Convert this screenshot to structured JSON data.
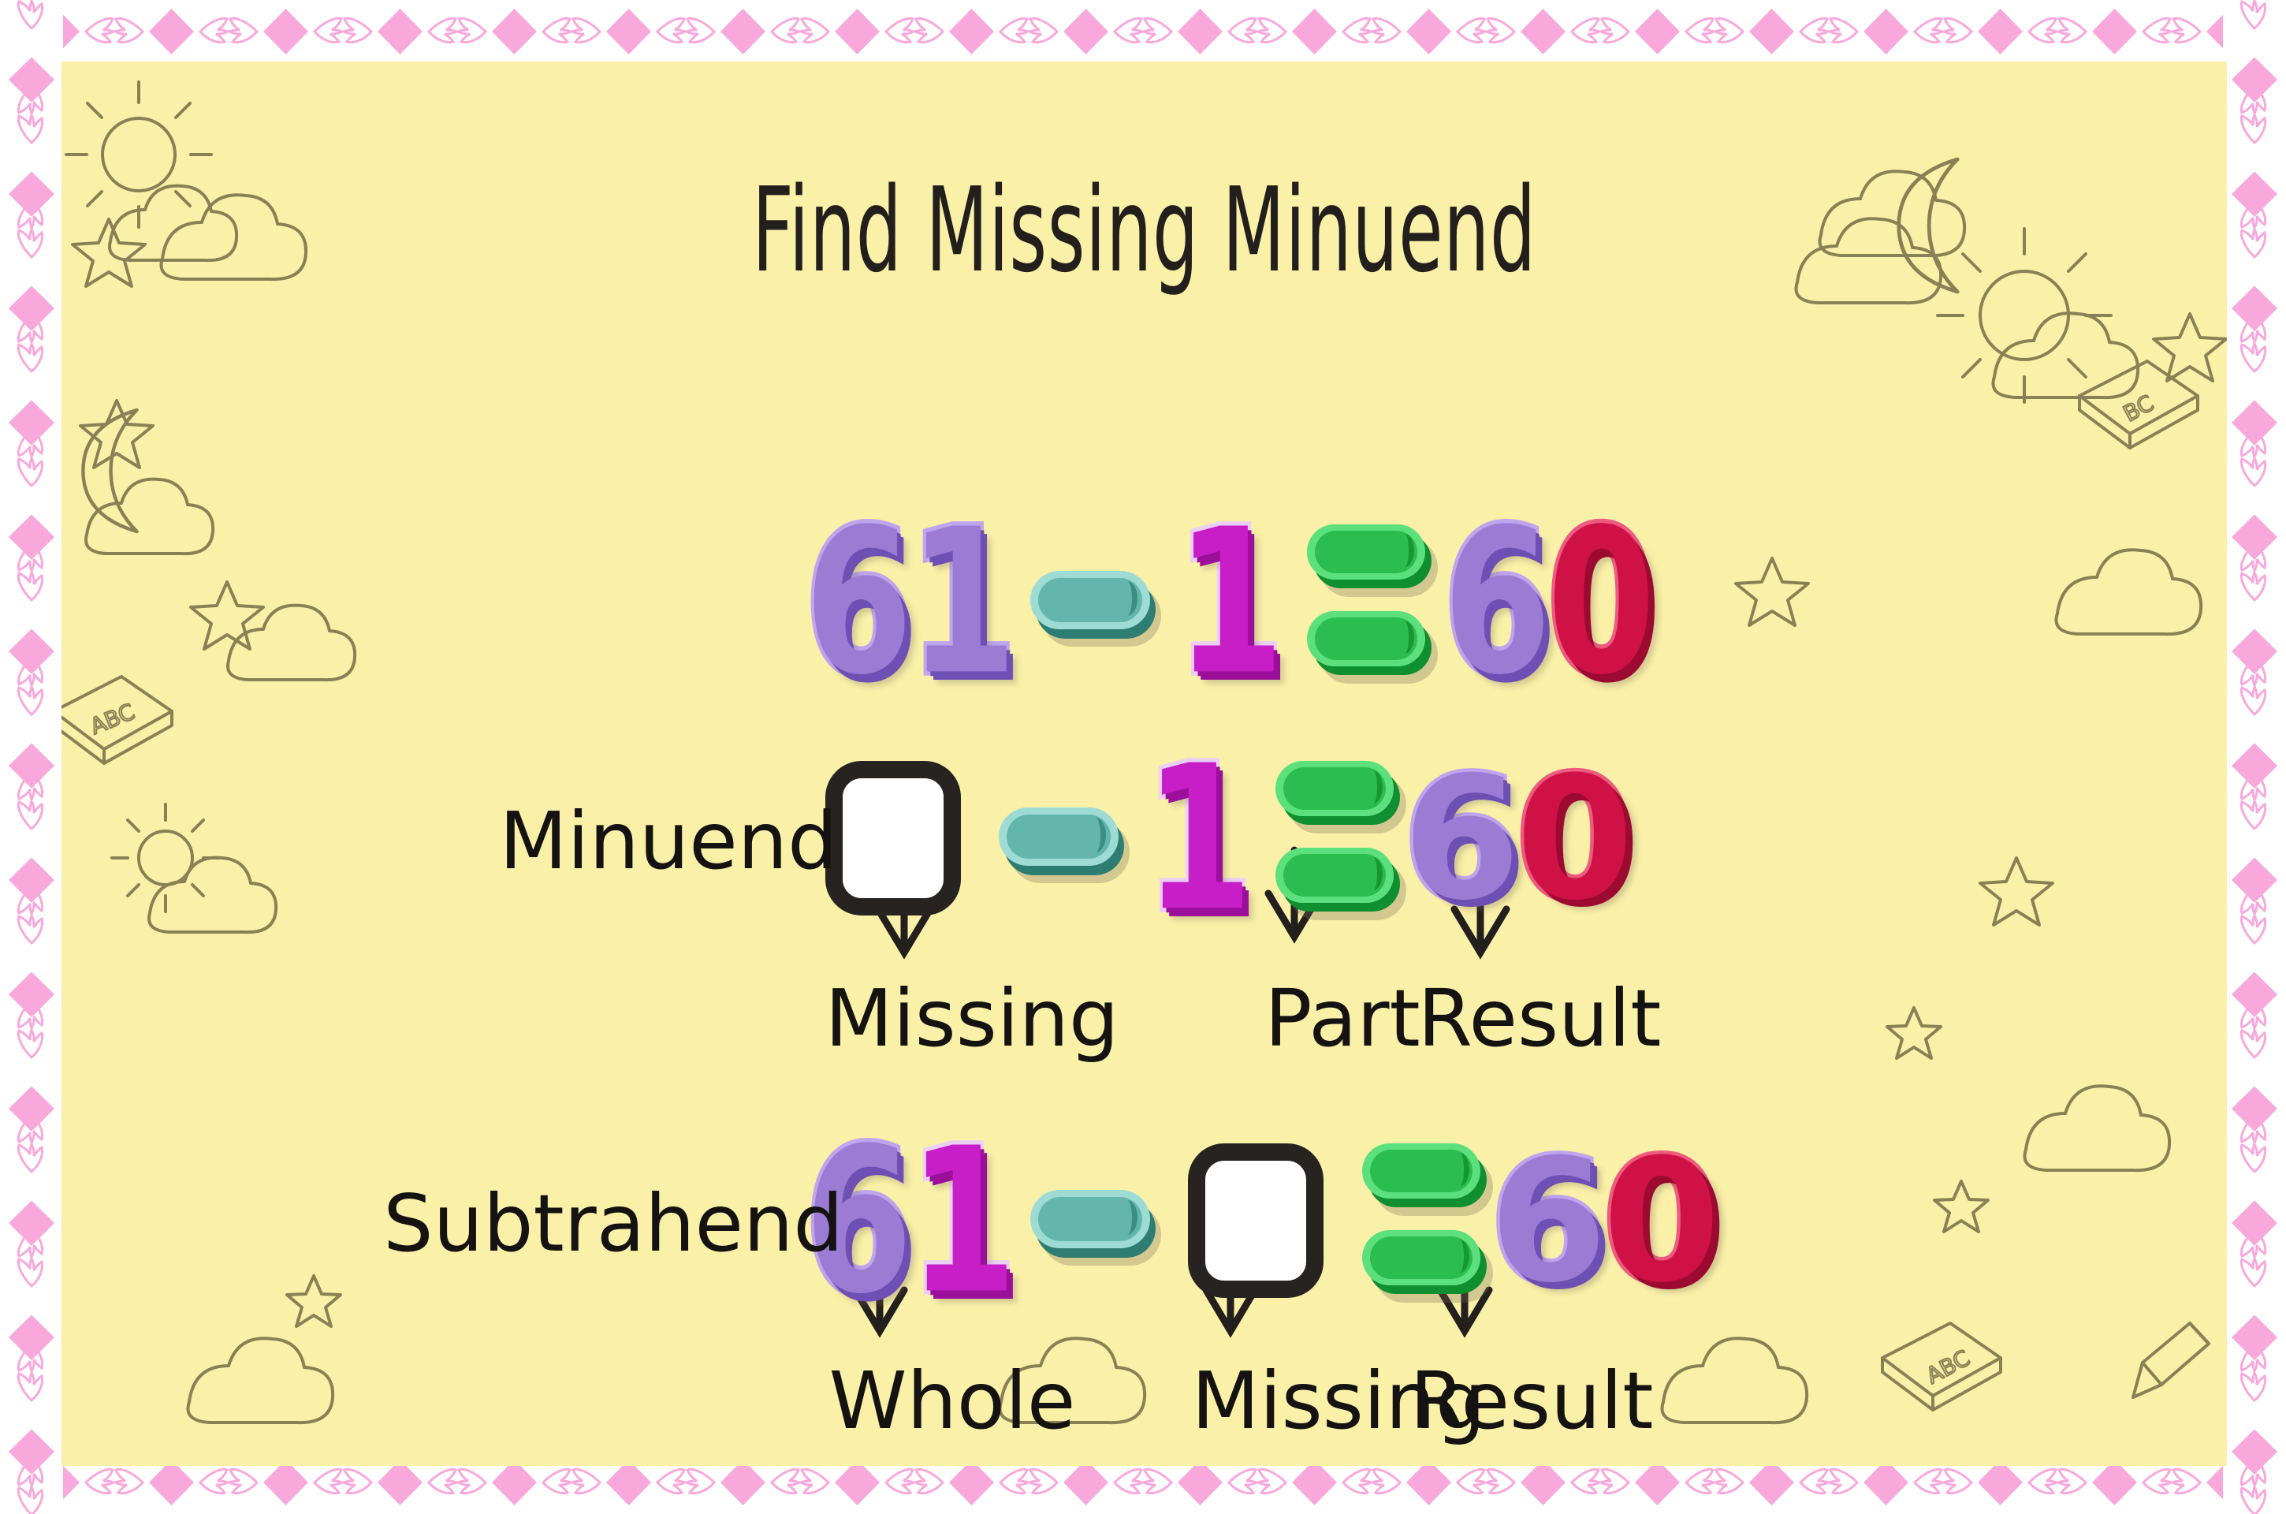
{
  "page": {
    "title": "Find Missing Minuend",
    "background_color": "#faf0a8",
    "border_color": "#f9a8dc",
    "doodle_color": "#8a8055"
  },
  "equations": {
    "example": {
      "row_id": "row-example",
      "minuend": "61",
      "operator": "minus-sign",
      "subtrahend": "1",
      "equals": "equals-sign",
      "result": "60"
    },
    "missing_minuend": {
      "row_id": "row-missing-minuend",
      "side_label": "Minuend",
      "minuend": "",
      "operator": "minus-sign",
      "subtrahend": "1",
      "equals": "equals-sign",
      "result": "60",
      "callouts": [
        "Missing",
        "Part",
        "Result"
      ]
    },
    "missing_subtrahend": {
      "row_id": "row-missing-subtrahend",
      "side_label": "Subtrahend",
      "minuend": "61",
      "operator": "minus-sign",
      "subtrahend": "",
      "equals": "equals-sign",
      "result": "60",
      "callouts": [
        "Whole",
        "Missing",
        "Result"
      ]
    }
  },
  "colors": {
    "digit_violet": "#9b7bd4",
    "digit_magenta": "#c71ec7",
    "digit_crimson": "#cf1145",
    "minus_teal": "#63b6ab",
    "equals_green": "#2cbd50",
    "answer_box_border": "#272320",
    "answer_box_fill": "#ffffff",
    "text_dark": "#151312"
  }
}
